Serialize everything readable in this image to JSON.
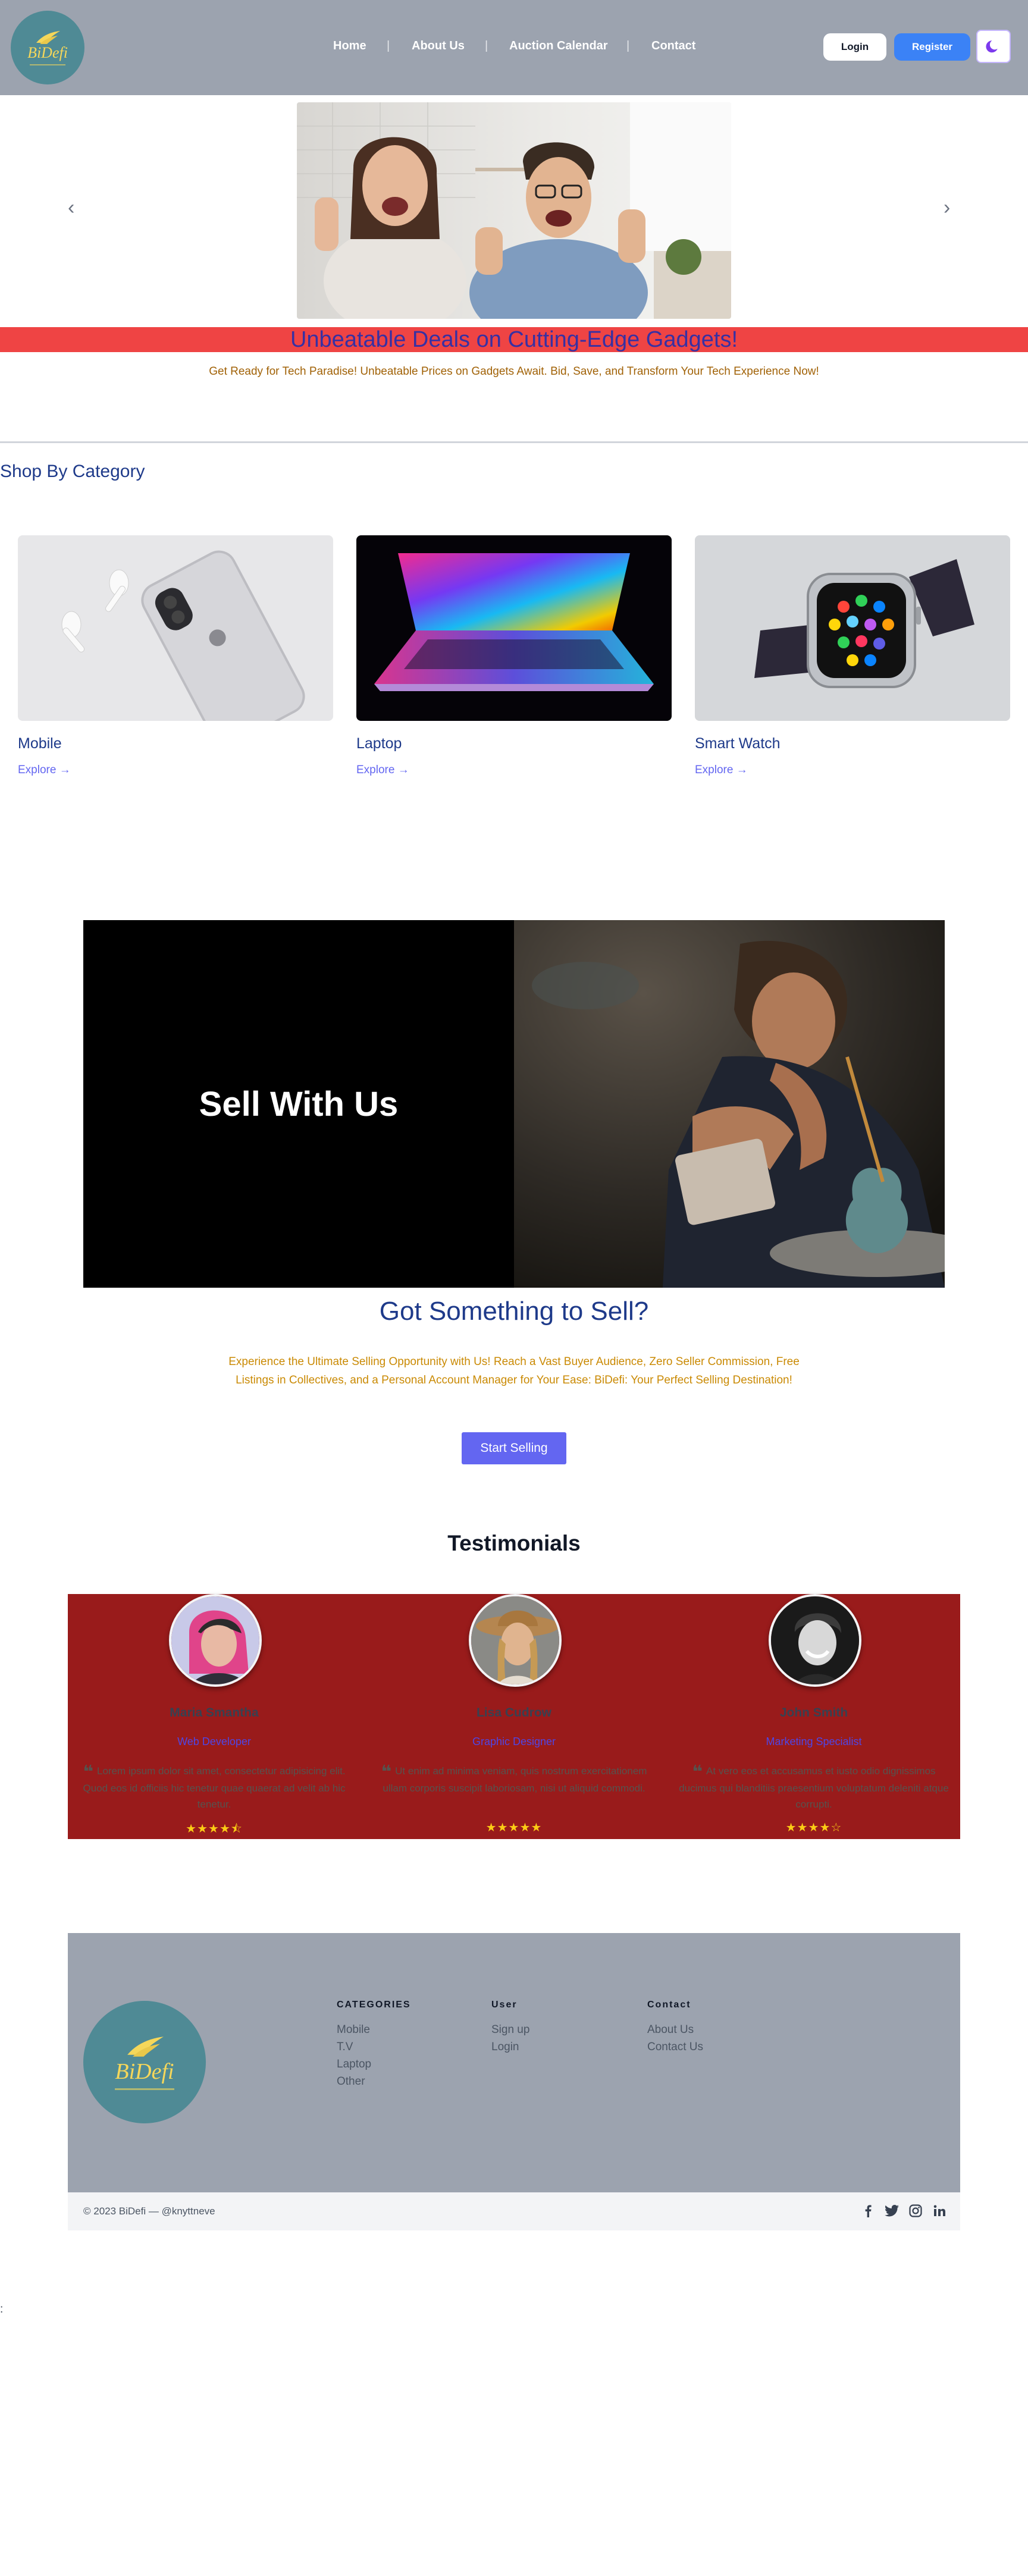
{
  "header": {
    "logo_text": "BiDefi",
    "nav": [
      "Home",
      "About Us",
      "Auction Calendar",
      "Contact"
    ],
    "separator": "|",
    "login": "Login",
    "register": "Register"
  },
  "hero": {
    "headline": "Unbeatable Deals on Cutting-Edge Gadgets!",
    "subline": "Get Ready for Tech Paradise! Unbeatable Prices on Gadgets Await. Bid, Save, and Transform Your Tech Experience Now!",
    "prev_arrow": "‹",
    "next_arrow": "›"
  },
  "categories": {
    "title": "Shop By Category",
    "explore_label": "Explore",
    "items": [
      {
        "name": "Mobile"
      },
      {
        "name": "Laptop"
      },
      {
        "name": "Smart Watch"
      }
    ]
  },
  "sell": {
    "banner": "Sell With Us",
    "title": "Got Something to Sell?",
    "description": "Experience the Ultimate Selling Opportunity with Us! Reach a Vast Buyer Audience, Zero Seller Commission, Free Listings in Collectives, and a Personal Account Manager for Your Ease: BiDefi: Your Perfect Selling Destination!",
    "button": "Start Selling"
  },
  "testimonials": {
    "title": "Testimonials",
    "items": [
      {
        "name": "Maria Smantha",
        "role": "Web Developer",
        "quote": "Lorem ipsum dolor sit amet, consectetur adipisicing elit. Quod eos id officiis hic tenetur quae quaerat ad velit ab hic tenetur.",
        "stars": "★★★★⯪"
      },
      {
        "name": "Lisa Cudrow",
        "role": "Graphic Designer",
        "quote": "Ut enim ad minima veniam, quis nostrum exercitationem ullam corporis suscipit laboriosam, nisi ut aliquid commodi.",
        "stars": "★★★★★"
      },
      {
        "name": "John Smith",
        "role": "Marketing Specialist",
        "quote": "At vero eos et accusamus et iusto odio dignissimos ducimus qui blanditiis praesentium voluptatum deleniti atque corrupti.",
        "stars": "★★★★☆"
      }
    ]
  },
  "footer": {
    "logo_text": "BiDefi",
    "columns": [
      {
        "heading": "CATEGORIES",
        "links": [
          "Mobile",
          "T.V",
          "Laptop",
          "Other"
        ]
      },
      {
        "heading": "User",
        "links": [
          "Sign up",
          "Login"
        ]
      },
      {
        "heading": "Contact",
        "links": [
          "About Us",
          "Contact Us"
        ]
      }
    ],
    "copyright": "© 2023 BiDefi — @knyttneve",
    "stray_char": ":"
  },
  "colors": {
    "header_bg": "#9ca3af",
    "banner_bg": "#ef4444",
    "accent": "#6366f1",
    "testimonial_bg": "#991b1b"
  }
}
